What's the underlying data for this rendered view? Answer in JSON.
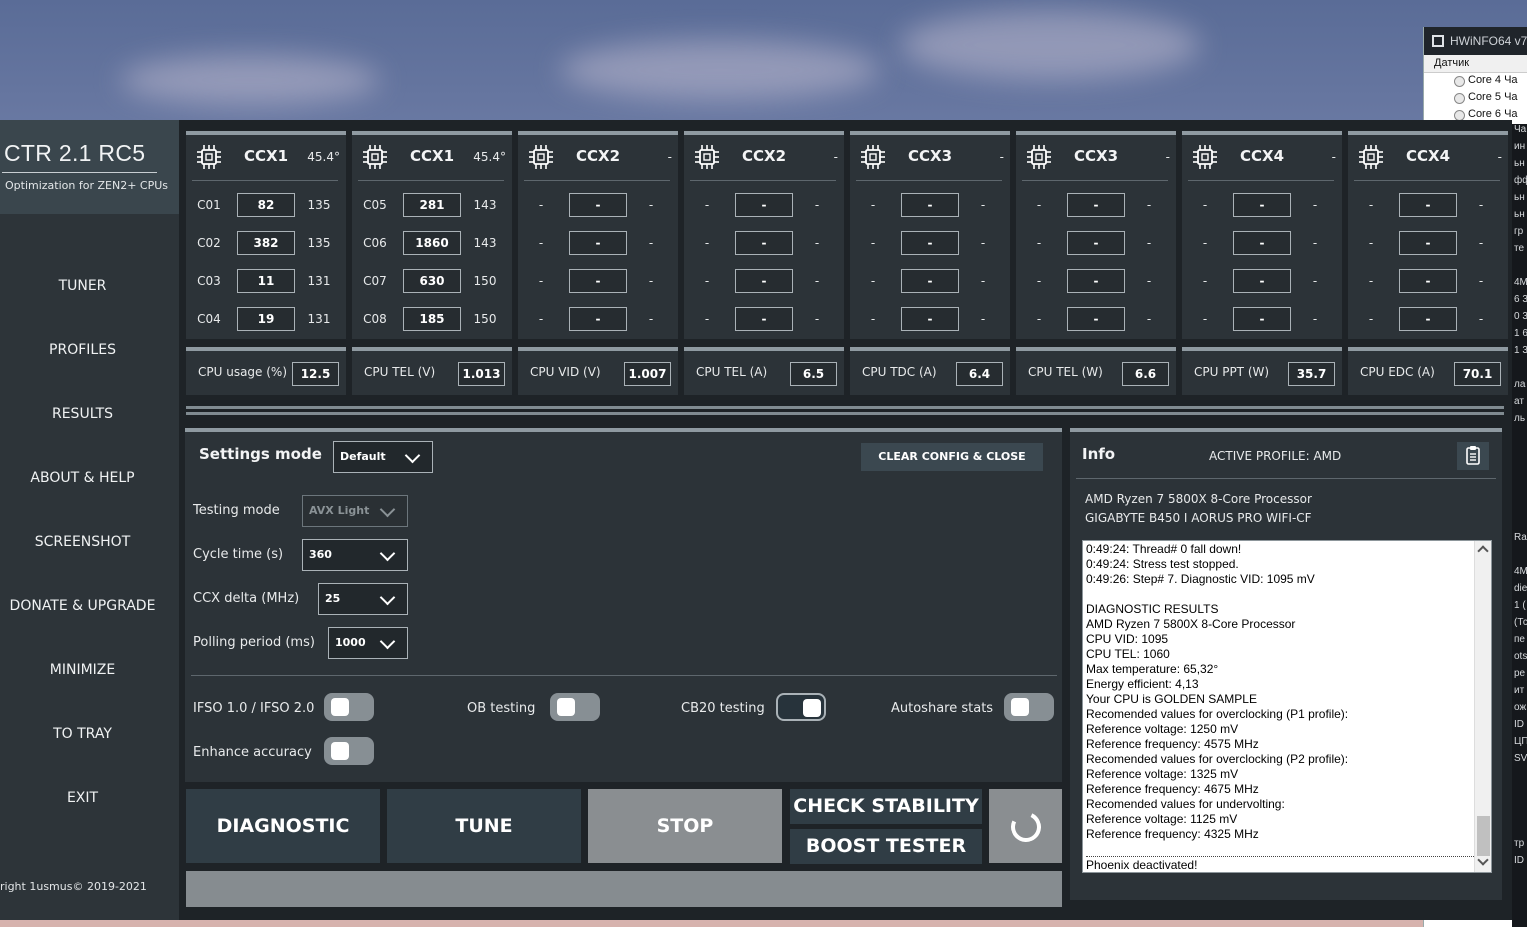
{
  "hwinfo": {
    "title": "HWiNFO64 v7",
    "header": "Датчик",
    "rows": [
      "Core 4 Ча",
      "Core 5 Ча",
      "Core 6 Ча"
    ],
    "strip": [
      "Ча",
      "ин",
      "ьн",
      "фф",
      "ьн",
      "ьн",
      "гр",
      "те",
      "",
      "4М",
      "6 3",
      "0 3",
      "1 6",
      "1 3",
      "",
      "ла",
      "ат",
      "ль",
      "",
      "",
      "",
      "",
      "",
      "",
      "Ra",
      "",
      "4М",
      "die",
      "1 (",
      "(Тс",
      "пе",
      "ots",
      "ре",
      "ит",
      "ож",
      "ID",
      "ЦП",
      "SVI",
      "",
      "",
      "",
      "",
      "тр",
      "ID"
    ]
  },
  "app": {
    "title": "CTR 2.1 RC5",
    "subtitle": "Optimization for ZEN2+ CPUs",
    "nav": [
      "TUNER",
      "PROFILES",
      "RESULTS",
      "ABOUT & HELP",
      "SCREENSHOT",
      "DONATE & UPGRADE",
      "MINIMIZE",
      "TO TRAY",
      "EXIT"
    ],
    "copyright": "right 1usmus© 2019-2021"
  },
  "ccx": [
    {
      "name": "CCX1",
      "temp": "45.4°",
      "cores": [
        {
          "id": "C01",
          "value": "82",
          "max": "135"
        },
        {
          "id": "C02",
          "value": "382",
          "max": "135"
        },
        {
          "id": "C03",
          "value": "11",
          "max": "131"
        },
        {
          "id": "C04",
          "value": "19",
          "max": "131"
        }
      ]
    },
    {
      "name": "CCX1",
      "temp": "45.4°",
      "cores": [
        {
          "id": "C05",
          "value": "281",
          "max": "143"
        },
        {
          "id": "C06",
          "value": "1860",
          "max": "143"
        },
        {
          "id": "C07",
          "value": "630",
          "max": "150"
        },
        {
          "id": "C08",
          "value": "185",
          "max": "150"
        }
      ]
    },
    {
      "name": "CCX2",
      "temp": "-",
      "cores": [
        {
          "id": "-",
          "value": "-",
          "max": "-"
        },
        {
          "id": "-",
          "value": "-",
          "max": "-"
        },
        {
          "id": "-",
          "value": "-",
          "max": "-"
        },
        {
          "id": "-",
          "value": "-",
          "max": "-"
        }
      ]
    },
    {
      "name": "CCX2",
      "temp": "-",
      "cores": [
        {
          "id": "-",
          "value": "-",
          "max": "-"
        },
        {
          "id": "-",
          "value": "-",
          "max": "-"
        },
        {
          "id": "-",
          "value": "-",
          "max": "-"
        },
        {
          "id": "-",
          "value": "-",
          "max": "-"
        }
      ]
    },
    {
      "name": "CCX3",
      "temp": "-",
      "cores": [
        {
          "id": "-",
          "value": "-",
          "max": "-"
        },
        {
          "id": "-",
          "value": "-",
          "max": "-"
        },
        {
          "id": "-",
          "value": "-",
          "max": "-"
        },
        {
          "id": "-",
          "value": "-",
          "max": "-"
        }
      ]
    },
    {
      "name": "CCX3",
      "temp": "-",
      "cores": [
        {
          "id": "-",
          "value": "-",
          "max": "-"
        },
        {
          "id": "-",
          "value": "-",
          "max": "-"
        },
        {
          "id": "-",
          "value": "-",
          "max": "-"
        },
        {
          "id": "-",
          "value": "-",
          "max": "-"
        }
      ]
    },
    {
      "name": "CCX4",
      "temp": "-",
      "cores": [
        {
          "id": "-",
          "value": "-",
          "max": "-"
        },
        {
          "id": "-",
          "value": "-",
          "max": "-"
        },
        {
          "id": "-",
          "value": "-",
          "max": "-"
        },
        {
          "id": "-",
          "value": "-",
          "max": "-"
        }
      ]
    },
    {
      "name": "CCX4",
      "temp": "-",
      "cores": [
        {
          "id": "-",
          "value": "-",
          "max": "-"
        },
        {
          "id": "-",
          "value": "-",
          "max": "-"
        },
        {
          "id": "-",
          "value": "-",
          "max": "-"
        },
        {
          "id": "-",
          "value": "-",
          "max": "-"
        }
      ]
    }
  ],
  "metrics": [
    {
      "label": "CPU usage (%)",
      "value": "12.5"
    },
    {
      "label": "CPU TEL (V)",
      "value": "1.013"
    },
    {
      "label": "CPU VID (V)",
      "value": "1.007"
    },
    {
      "label": "CPU TEL (A)",
      "value": "6.5"
    },
    {
      "label": "CPU TDC (A)",
      "value": "6.4"
    },
    {
      "label": "CPU TEL (W)",
      "value": "6.6"
    },
    {
      "label": "CPU PPT (W)",
      "value": "35.7"
    },
    {
      "label": "CPU EDC (A)",
      "value": "70.1"
    }
  ],
  "settings": {
    "title": "Settings mode",
    "mode": "Default",
    "clear_label": "CLEAR CONFIG & CLOSE",
    "testing_mode_label": "Testing mode",
    "testing_mode_value": "AVX Light",
    "cycle_time_label": "Cycle time (s)",
    "cycle_time_value": "360",
    "ccx_delta_label": "CCX delta (MHz)",
    "ccx_delta_value": "25",
    "polling_label": "Polling period (ms)",
    "polling_value": "1000",
    "toggles": [
      {
        "label": "IFSO 1.0 / IFSO 2.0",
        "on": false
      },
      {
        "label": "OB testing",
        "on": false
      },
      {
        "label": "CB20 testing",
        "on": true
      },
      {
        "label": "Autoshare stats",
        "on": false
      },
      {
        "label": "Enhance accuracy",
        "on": false
      }
    ]
  },
  "info": {
    "title": "Info",
    "active_profile": "ACTIVE PROFILE: AMD",
    "cpu": "AMD Ryzen 7 5800X 8-Core Processor",
    "board": "GIGABYTE B450 I AORUS PRO WIFI-CF",
    "log": [
      "0:49:24: Thread# 0 fall down!",
      "0:49:24: Stress test stopped.",
      "0:49:26: Step# 7. Diagnostic VID: 1095 mV",
      "",
      "DIAGNOSTIC RESULTS",
      "AMD Ryzen 7 5800X 8-Core Processor",
      "CPU VID: 1095",
      "CPU TEL: 1060",
      "Max temperature: 65,32°",
      "Energy efficient: 4,13",
      "Your CPU is GOLDEN SAMPLE",
      "Recomended values for overclocking (P1 profile):",
      "Reference voltage: 1250 mV",
      "Reference frequency: 4575 MHz",
      "Recomended values for overclocking (P2 profile):",
      "Reference voltage: 1325 mV",
      "Reference frequency: 4675 MHz",
      "Recomended values for undervolting:",
      "Reference voltage: 1125 mV",
      "Reference frequency: 4325 MHz"
    ],
    "log_last": "Phoenix deactivated!"
  },
  "actions": {
    "diagnostic": "DIAGNOSTIC",
    "tune": "TUNE",
    "stop": "STOP",
    "check_stability": "CHECK STABILITY",
    "boost_tester": "BOOST TESTER"
  }
}
